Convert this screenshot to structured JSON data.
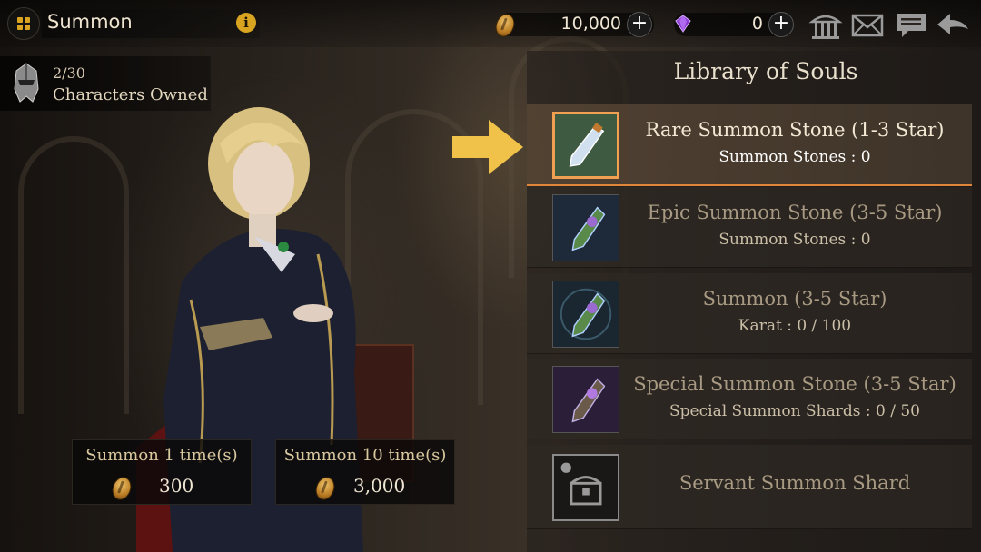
{
  "header": {
    "title": "Summon"
  },
  "currencies": {
    "gold": "10,000",
    "gems": "0"
  },
  "owned": {
    "count": "2/30",
    "label": "Characters Owned"
  },
  "panel": {
    "title": "Library of Souls",
    "items": [
      {
        "name": "Rare Summon Stone (1-3 Star)",
        "sub": "Summon Stones : 0"
      },
      {
        "name": "Epic Summon Stone (3-5 Star)",
        "sub": "Summon Stones : 0"
      },
      {
        "name": "Summon (3-5 Star)",
        "sub": "Karat : 0 / 100"
      },
      {
        "name": "Special Summon Stone (3-5 Star)",
        "sub": "Special Summon Shards : 0 / 50"
      },
      {
        "name": "Servant Summon Shard"
      }
    ]
  },
  "summon_buttons": [
    {
      "label": "Summon 1 time(s)",
      "cost": "300"
    },
    {
      "label": "Summon 10 time(s)",
      "cost": "3,000"
    }
  ],
  "icons": {
    "menu": "grid-menu-icon",
    "info": "info-icon",
    "coin": "coin-icon",
    "gem": "purple-gem-icon",
    "temple": "temple-icon",
    "mail": "mail-icon",
    "chat": "chat-icon",
    "back": "back-arrow-icon",
    "helm": "helmet-icon",
    "arrow": "yellow-arrow-icon",
    "chest": "treasure-chest-icon"
  },
  "colors": {
    "accent": "#d9a520",
    "selected_border": "#f0a050",
    "selected_underline": "#e0863a"
  }
}
